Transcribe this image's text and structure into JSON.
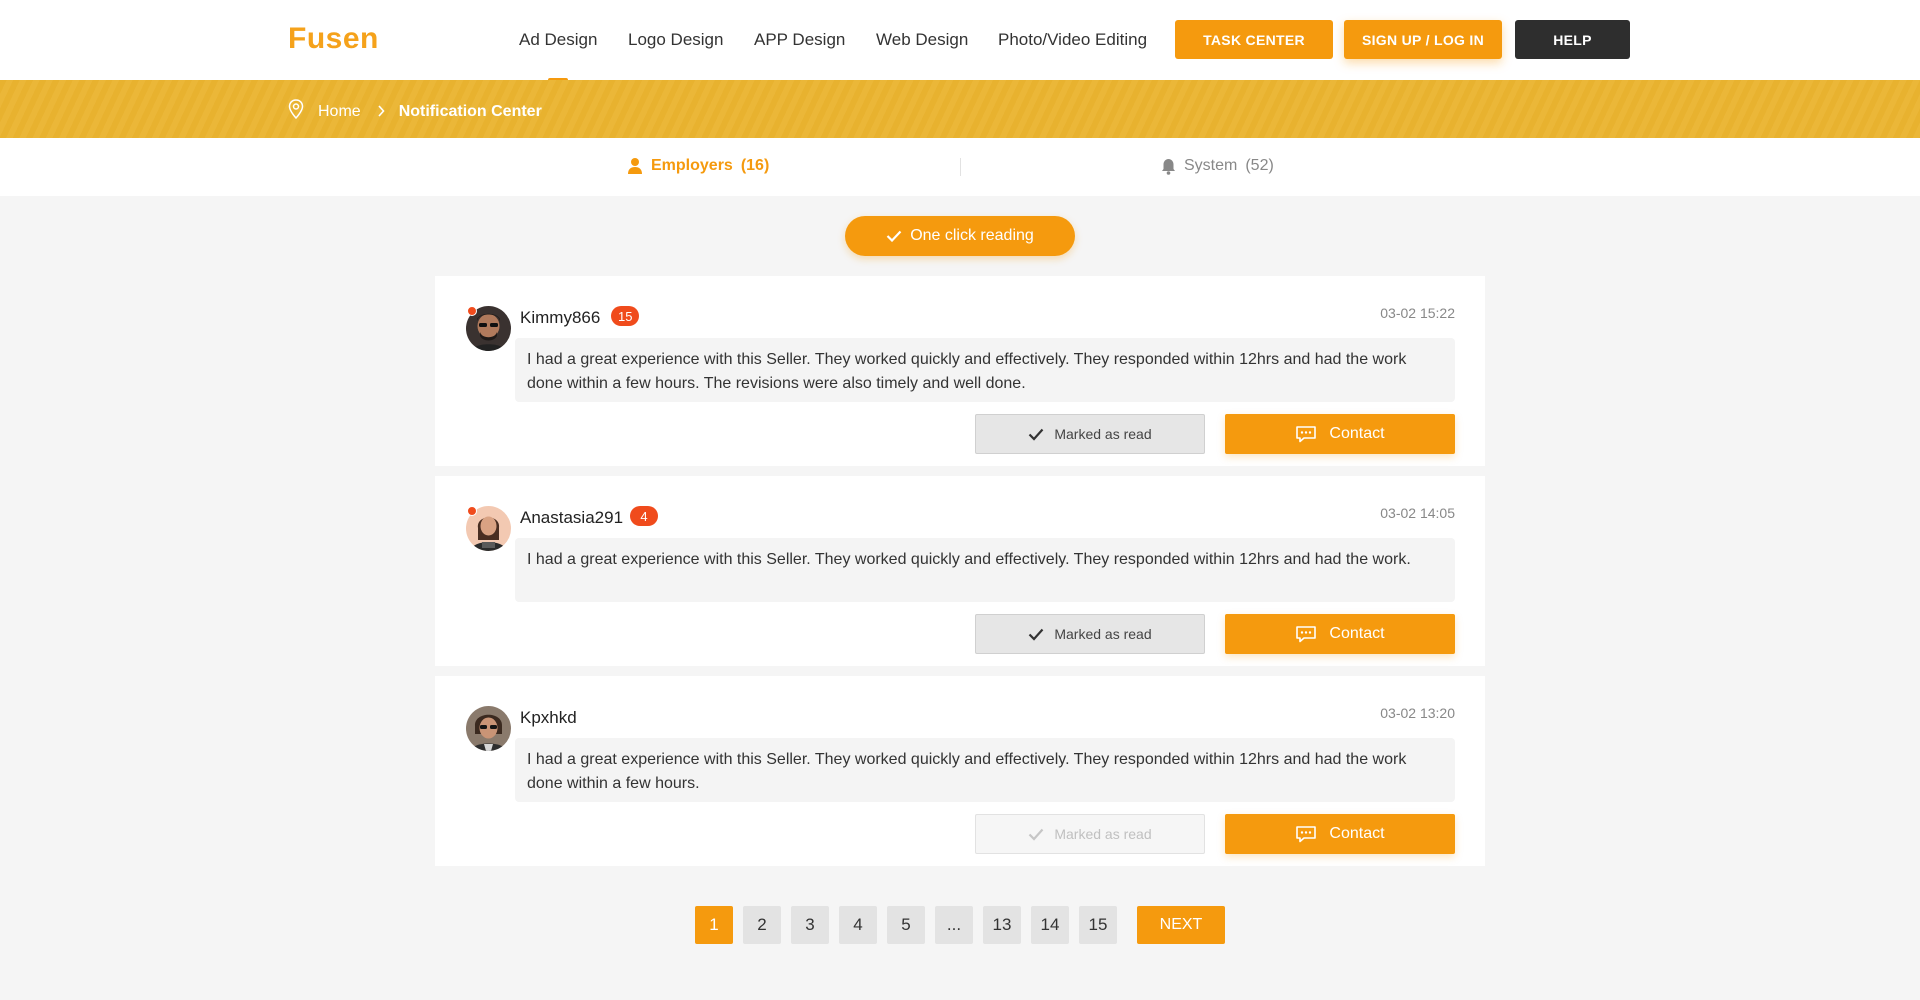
{
  "header": {
    "logo": "Fusen",
    "nav": [
      "Ad Design",
      "Logo Design",
      "APP Design",
      "Web Design",
      "Photo/Video Editing"
    ],
    "active_nav": "Ad Design",
    "task_center": "TASK CENTER",
    "sign_up": "SIGN UP / LOG IN",
    "help": "HELP"
  },
  "breadcrumb": {
    "home": "Home",
    "current": "Notification Center"
  },
  "tabs": {
    "employers_label": "Employers",
    "employers_count": "(16)",
    "system_label": "System",
    "system_count": "(52)",
    "active": "Employers"
  },
  "one_click": "One click reading",
  "notifications": [
    {
      "username": "Kimmy866",
      "badge": "15",
      "unread_dot": true,
      "time": "03-02 15:22",
      "message": "I had a great experience with this Seller. They worked quickly and effectively. They responded within 12hrs and had the work done within a few hours. The revisions were also timely and well done.",
      "read_label": "Marked as read",
      "contact_label": "Contact"
    },
    {
      "username": "Anastasia291",
      "badge": "4",
      "unread_dot": true,
      "time": "03-02 14:05",
      "message": "I had a great experience with this Seller. They worked quickly and effectively. They responded within 12hrs and had the work.",
      "read_label": "Marked as read",
      "contact_label": "Contact"
    },
    {
      "username": "Kpxhkd",
      "badge": "",
      "unread_dot": false,
      "time": "03-02 13:20",
      "message": "I had a great experience with this Seller. They worked quickly and effectively. They responded within 12hrs and had the work done within a few hours.",
      "read_label": "Marked as read",
      "contact_label": "Contact"
    }
  ],
  "pagination": {
    "pages": [
      "1",
      "2",
      "3",
      "4",
      "5",
      "...",
      "13",
      "14",
      "15"
    ],
    "current": "1",
    "next": "NEXT"
  },
  "colors": {
    "accent": "#f59a0e",
    "banner": "#e8b22f",
    "badge": "#f04b1c",
    "help_button": "#2e2e2e"
  }
}
